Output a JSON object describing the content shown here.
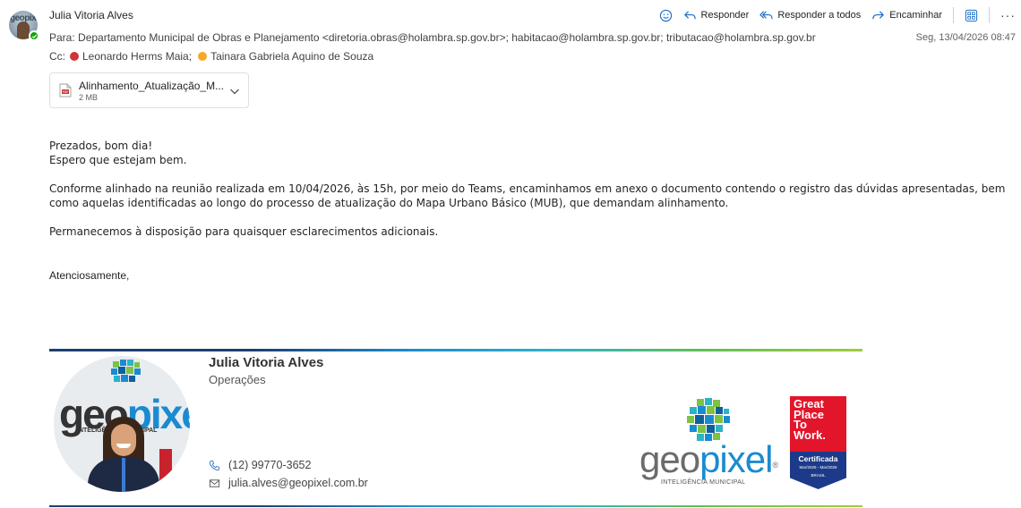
{
  "email": {
    "sender_name": "Julia Vitoria Alves",
    "avatar_text": "geopixel",
    "to_label": "Para:",
    "to_recipients": "Departamento Municipal de Obras e Planejamento <diretoria.obras@holambra.sp.gov.br>;  habitacao@holambra.sp.gov.br;  tributacao@holambra.sp.gov.br",
    "cc_label": "Cc:",
    "cc_recipients": [
      {
        "name": "Leonardo Herms Maia;",
        "status_color": "#d13438"
      },
      {
        "name": "Tainara Gabriela Aquino de Souza",
        "status_color": "#f7a823"
      }
    ],
    "date": "Seg, 13/04/2026 08:47"
  },
  "actions": {
    "reply": "Responder",
    "reply_all": "Responder a todos",
    "forward": "Encaminhar",
    "more": "···"
  },
  "attachment": {
    "name": "Alinhamento_Atualização_M...",
    "size": "2 MB",
    "icon": "pdf-icon"
  },
  "body": {
    "greeting": "Prezados, bom dia!",
    "line2": "Espero que estejam bem.",
    "paragraph": "Conforme alinhado na reunião realizada em 10/04/2026, às 15h, por meio do Teams, encaminhamos em anexo o documento contendo o registro das dúvidas apresentadas, bem como aquelas identificadas ao longo do processo de atualização do Mapa Urbano Básico (MUB), que demandam alinhamento.",
    "closing_para": "Permanecemos à disposição para quaisquer esclarecimentos adicionais.",
    "signoff": "Atenciosamente,"
  },
  "signature": {
    "name": "Julia Vitoria Alves",
    "role": "Operações",
    "phone": "(12) 99770-3652",
    "email": "julia.alves@geopixel.com.br",
    "photo_brand_geo": "geo",
    "photo_brand_px": "pixel",
    "photo_brand_sub": "INTELIGÊNCIA MUNICIPAL",
    "logo_geo": "geo",
    "logo_px": "pixel",
    "logo_reg": "®",
    "logo_sub": "INTELIGÊNCIA MUNICIPAL",
    "gptw_lines": [
      "Great",
      "Place",
      "To",
      "Work."
    ],
    "gptw_cert": "Certificada",
    "gptw_period": "Mar/2025 - Mar/2026",
    "gptw_country": "BRASIL"
  },
  "colors": {
    "accent_blue": "#1b8bd1",
    "presence_green": "#13a10e",
    "gptw_red": "#e3152b",
    "gptw_blue": "#1d3a8a"
  }
}
